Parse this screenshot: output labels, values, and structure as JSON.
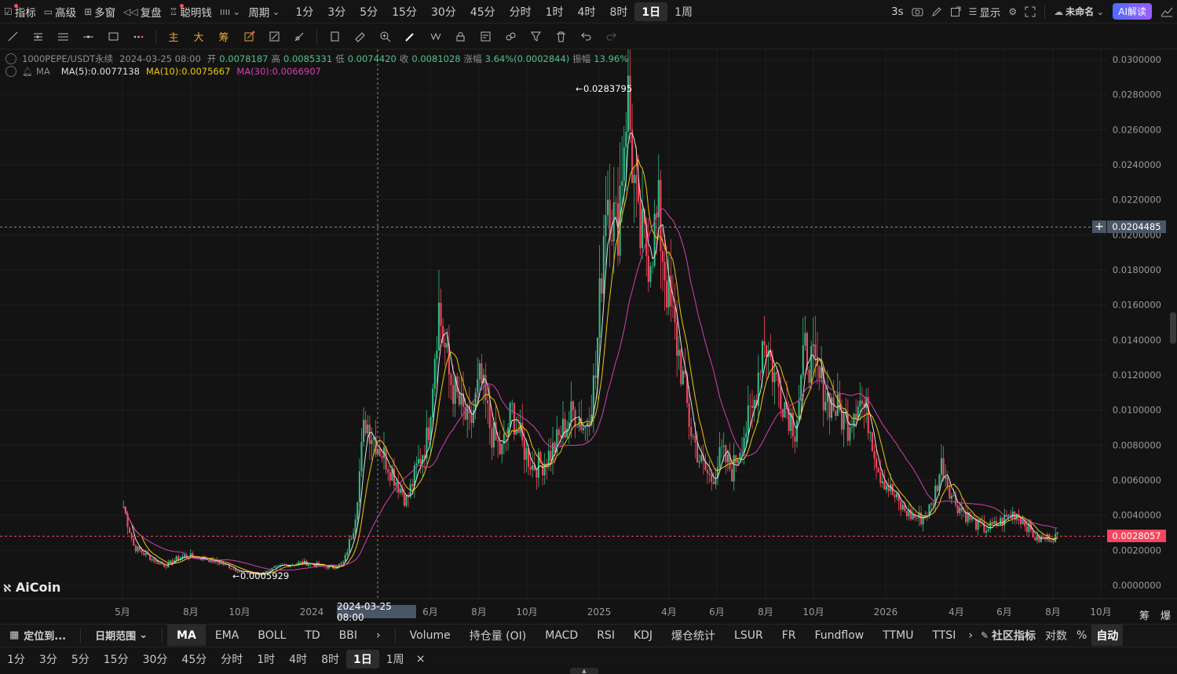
{
  "topbar": {
    "items": [
      {
        "icon": "indicator-icon",
        "label": "指标",
        "dot": true
      },
      {
        "icon": "advanced-icon",
        "label": "高级",
        "dot": false
      },
      {
        "icon": "multi-window-icon",
        "label": "多窗",
        "dot": false
      },
      {
        "icon": "replay-icon",
        "label": "复盘",
        "dot": false
      },
      {
        "icon": "smart-money-icon",
        "label": "聪明钱",
        "dot": true
      }
    ],
    "period_menu": "周期",
    "periods": [
      "1分",
      "3分",
      "5分",
      "15分",
      "30分",
      "45分",
      "分时",
      "1时",
      "4时",
      "8时",
      "1日",
      "1周"
    ],
    "active_period": "1日",
    "refresh": "3s",
    "display": "显示",
    "account": "未命名",
    "ai_button": "AI解读"
  },
  "drawtools": {
    "text_tools": [
      "主",
      "大",
      "筹"
    ]
  },
  "legend": {
    "symbol": "1000PEPE/USDT永续",
    "date": "2024-03-25 08:00",
    "open_label": "开",
    "open": "0.0078187",
    "high_label": "高",
    "high": "0.0085331",
    "low_label": "低",
    "low": "0.0074420",
    "close_label": "收",
    "close": "0.0081028",
    "change_label": "涨幅",
    "change": "3.64%(0.0002844)",
    "amp_label": "振幅",
    "amp": "13.96%",
    "ma_name": "MA",
    "ma5": "MA(5):0.0077138",
    "ma10": "MA(10):0.0075667",
    "ma30": "MA(30):0.0066907"
  },
  "colors": {
    "up": "#2ebd85",
    "down": "#f6465d",
    "ma5": "#e0e0e0",
    "ma10": "#f0c808",
    "ma30": "#d63fb1",
    "bg": "#131313"
  },
  "chart_data": {
    "type": "candlestick",
    "symbol": "1000PEPE/USDT永续",
    "y_ticks": [
      "0.0300000",
      "0.0280000",
      "0.0260000",
      "0.0240000",
      "0.0220000",
      "0.0200000",
      "0.0180000",
      "0.0160000",
      "0.0140000",
      "0.0120000",
      "0.0100000",
      "0.0080000",
      "0.0060000",
      "0.0040000",
      "0.0020000",
      "0.0000000"
    ],
    "ylim": [
      0,
      0.03
    ],
    "x_labels": [
      "5月",
      "8月",
      "10月",
      "2024",
      "6月",
      "8月",
      "10月",
      "2025",
      "4月",
      "6月",
      "8月",
      "10月",
      "2026",
      "4月",
      "6月",
      "8月",
      "10月"
    ],
    "crosshair_date": "2024-03-25 08:00",
    "crosshair_price": "0.0204485",
    "last_price": "0.0028057",
    "max_label": "0.0283795",
    "min_label": "0.0005929",
    "series_close": [
      0.0045,
      0.0022,
      0.0018,
      0.0014,
      0.0011,
      0.0015,
      0.0017,
      0.0016,
      0.0015,
      0.0013,
      0.0011,
      0.0008,
      0.0007,
      0.0006,
      0.0009,
      0.0011,
      0.0012,
      0.0013,
      0.0012,
      0.0011,
      0.001,
      0.0013,
      0.0035,
      0.0095,
      0.0083,
      0.0072,
      0.006,
      0.0048,
      0.0068,
      0.0085,
      0.016,
      0.012,
      0.0103,
      0.009,
      0.0118,
      0.0088,
      0.0075,
      0.01,
      0.008,
      0.0068,
      0.007,
      0.0078,
      0.009,
      0.01,
      0.009,
      0.012,
      0.023,
      0.02,
      0.0284,
      0.02,
      0.019,
      0.021,
      0.016,
      0.013,
      0.009,
      0.007,
      0.006,
      0.0075,
      0.0065,
      0.0085,
      0.01,
      0.0145,
      0.012,
      0.0105,
      0.009,
      0.0135,
      0.012,
      0.0108,
      0.01,
      0.0092,
      0.0108,
      0.0095,
      0.0065,
      0.0055,
      0.0045,
      0.004,
      0.0038,
      0.0045,
      0.007,
      0.005,
      0.0042,
      0.0036,
      0.0032,
      0.0034,
      0.0038,
      0.0042,
      0.0035,
      0.0026,
      0.0027,
      0.0028
    ]
  },
  "watermark": "AiCoin",
  "indicators": {
    "main": [
      "MA",
      "EMA",
      "BOLL",
      "TD",
      "BBI"
    ],
    "active_main": "MA",
    "locate": "定位到...",
    "date_range": "日期范围",
    "sub": [
      "Volume",
      "持仓量 (OI)",
      "MACD",
      "RSI",
      "KDJ",
      "爆仓统计",
      "LSUR",
      "FR",
      "Fundflow",
      "TTMU",
      "TTSI"
    ],
    "community": "社区指标",
    "log": "对数",
    "percent": "%",
    "auto": "自动"
  },
  "period_bar": {
    "periods": [
      "1分",
      "3分",
      "5分",
      "15分",
      "30分",
      "45分",
      "分时",
      "1时",
      "4时",
      "8时",
      "1日",
      "1周"
    ],
    "active": "1日",
    "close": "×"
  },
  "side_labels": [
    "筹",
    "爆"
  ]
}
